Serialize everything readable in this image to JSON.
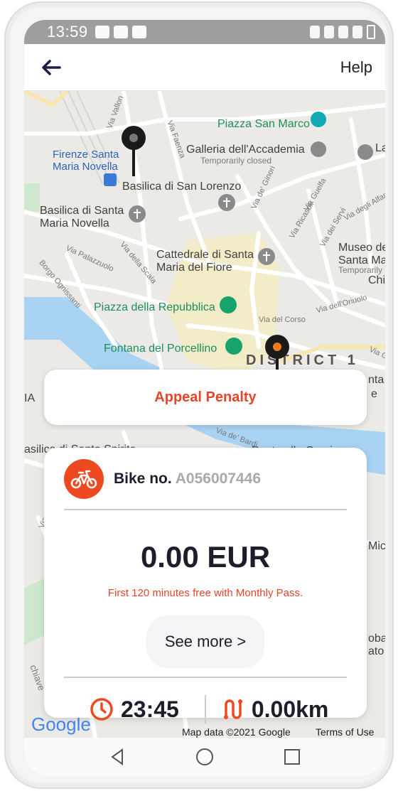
{
  "status_bar": {
    "time": "13:59"
  },
  "app_bar": {
    "help_label": "Help"
  },
  "map": {
    "places": {
      "piazza_san_marco": "Piazza San Marco",
      "galleria": "Galleria dell'Accademia",
      "galleria_status": "Temporarily closed",
      "firenze_smn": "Firenze Santa\nMaria Novella",
      "basilica_san_lorenzo": "Basilica di San Lorenzo",
      "basilica_smn": "Basilica di Santa\nMaria Novella",
      "cattedrale": "Cattedrale di Santa\nMaria del Fiore",
      "museo": "Museo dell'O\nSanta Maria d",
      "museo_status": "Temporarily clos",
      "piazza_repubblica": "Piazza della Repubblica",
      "fontana": "Fontana del Porcellino",
      "district": "DISTRICT 1",
      "ponte": "Ponte alle Grazie",
      "chi": "Chi",
      "la": "La",
      "nta": "nta",
      "e": "e",
      "ia": "IA",
      "asilica": "asilica di Santo Spirito",
      "mic": "Mic",
      "obaz": "obaz",
      "ato": "ato"
    },
    "streets": {
      "vallon": "Via Vallon",
      "faenza": "Via Faenza",
      "ginori": "Via de' Ginori",
      "guelfa": "Via Guelfa",
      "ricasoli": "Via Ricasoli",
      "servi": "Via dei Servi",
      "alfani": "Via degli Alfani",
      "palazzuolo": "Via Palazzuolo",
      "ognissanti": "Borgo Ognissanti",
      "scala": "Via della Scala",
      "oriuolo": "Via dell'Oriuolo",
      "corso": "Via del Corso",
      "ghib": "Via Ghib",
      "bardi": "Via de' Bardi",
      "serragli": "Via dei Serragli",
      "chiave": "chiave"
    },
    "attribution": "Map data ©2021 Google",
    "terms": "Terms of Use",
    "google_logo": "Google"
  },
  "appeal": {
    "label": "Appeal Penalty"
  },
  "ride": {
    "bike_label": "Bike no.",
    "bike_id": "A056007446",
    "price": "0.00 EUR",
    "promo": "First 120 minutes free with Monthly Pass.",
    "see_more": "See more >",
    "duration": "23:45",
    "distance": "0.00km"
  },
  "colors": {
    "accent": "#ee4a22",
    "text": "#1d1d2b",
    "muted": "#a8a8b0"
  }
}
